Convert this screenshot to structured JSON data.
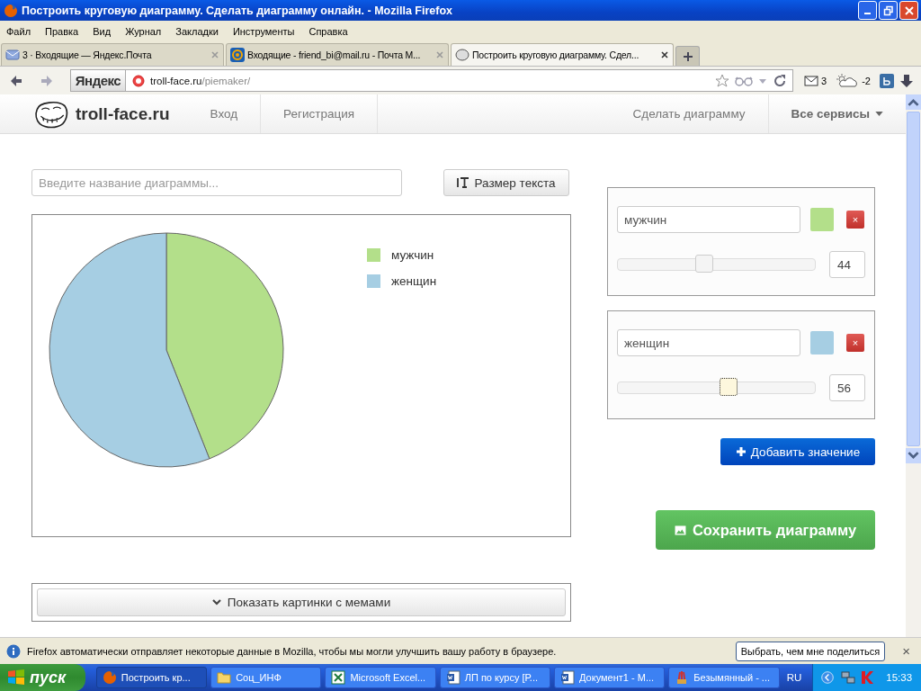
{
  "window": {
    "title": "Построить круговую диаграмму. Сделать диаграмму онлайн. - Mozilla Firefox"
  },
  "menu": [
    "Файл",
    "Правка",
    "Вид",
    "Журнал",
    "Закладки",
    "Инструменты",
    "Справка"
  ],
  "tabs": [
    {
      "label": "3 · Входящие — Яндекс.Почта",
      "kind": "mail",
      "selected": false
    },
    {
      "label": "Входящие - friend_bi@mail.ru - Почта М...",
      "kind": "at",
      "selected": false
    },
    {
      "label": "Построить круговую диаграмму. Сдел...",
      "kind": "troll",
      "selected": true
    }
  ],
  "nav": {
    "search_logo": "Яндекс",
    "url_host": "troll-face.ru",
    "url_path": "/piemaker/",
    "mail_count": "3",
    "weather": "-2"
  },
  "site": {
    "logo": "troll-face.ru",
    "nav_left": [
      "Вход",
      "Регистрация"
    ],
    "nav_right": [
      {
        "label": "Сделать диаграмму",
        "kind": "link"
      },
      {
        "label": "Все сервисы",
        "kind": "dropdown"
      }
    ]
  },
  "editor": {
    "title_placeholder": "Введите название диаграммы...",
    "text_size_button": "Размер текста",
    "chart_data": {
      "type": "pie",
      "categories": [
        "мужчин",
        "женщин"
      ],
      "values": [
        44,
        56
      ]
    },
    "memes_button": "Показать картинки с мемами"
  },
  "entries": [
    {
      "name": "мужчин",
      "color": "#b3df8a",
      "delete": "×",
      "level": 0.44,
      "value": "44"
    },
    {
      "name": "женщин",
      "color": "#a6cee3",
      "delete": "×",
      "level": 0.56,
      "value": "56"
    }
  ],
  "add_button": "Добавить значение",
  "save_button": "Сохранить диаграмму",
  "notification": {
    "text": "Firefox автоматически отправляет некоторые данные в Mozilla, чтобы мы могли улучшить вашу работу в браузере.",
    "button": "Выбрать, чем мне поделиться",
    "close": "×"
  },
  "taskbar": {
    "start": "пуск",
    "tasks": [
      {
        "label": "Построить кр...",
        "kind": "firefox",
        "selected": true
      },
      {
        "label": "Соц_ИНФ",
        "kind": "folder",
        "selected": false
      },
      {
        "label": "Microsoft Excel...",
        "kind": "excel",
        "selected": false
      },
      {
        "label": "ЛП по курсу [Р...",
        "kind": "word",
        "selected": false
      },
      {
        "label": "Документ1 - М...",
        "kind": "word",
        "selected": false
      },
      {
        "label": "Безымянный - ...",
        "kind": "paint",
        "selected": false
      }
    ],
    "language": "RU",
    "clock": "15:33"
  }
}
